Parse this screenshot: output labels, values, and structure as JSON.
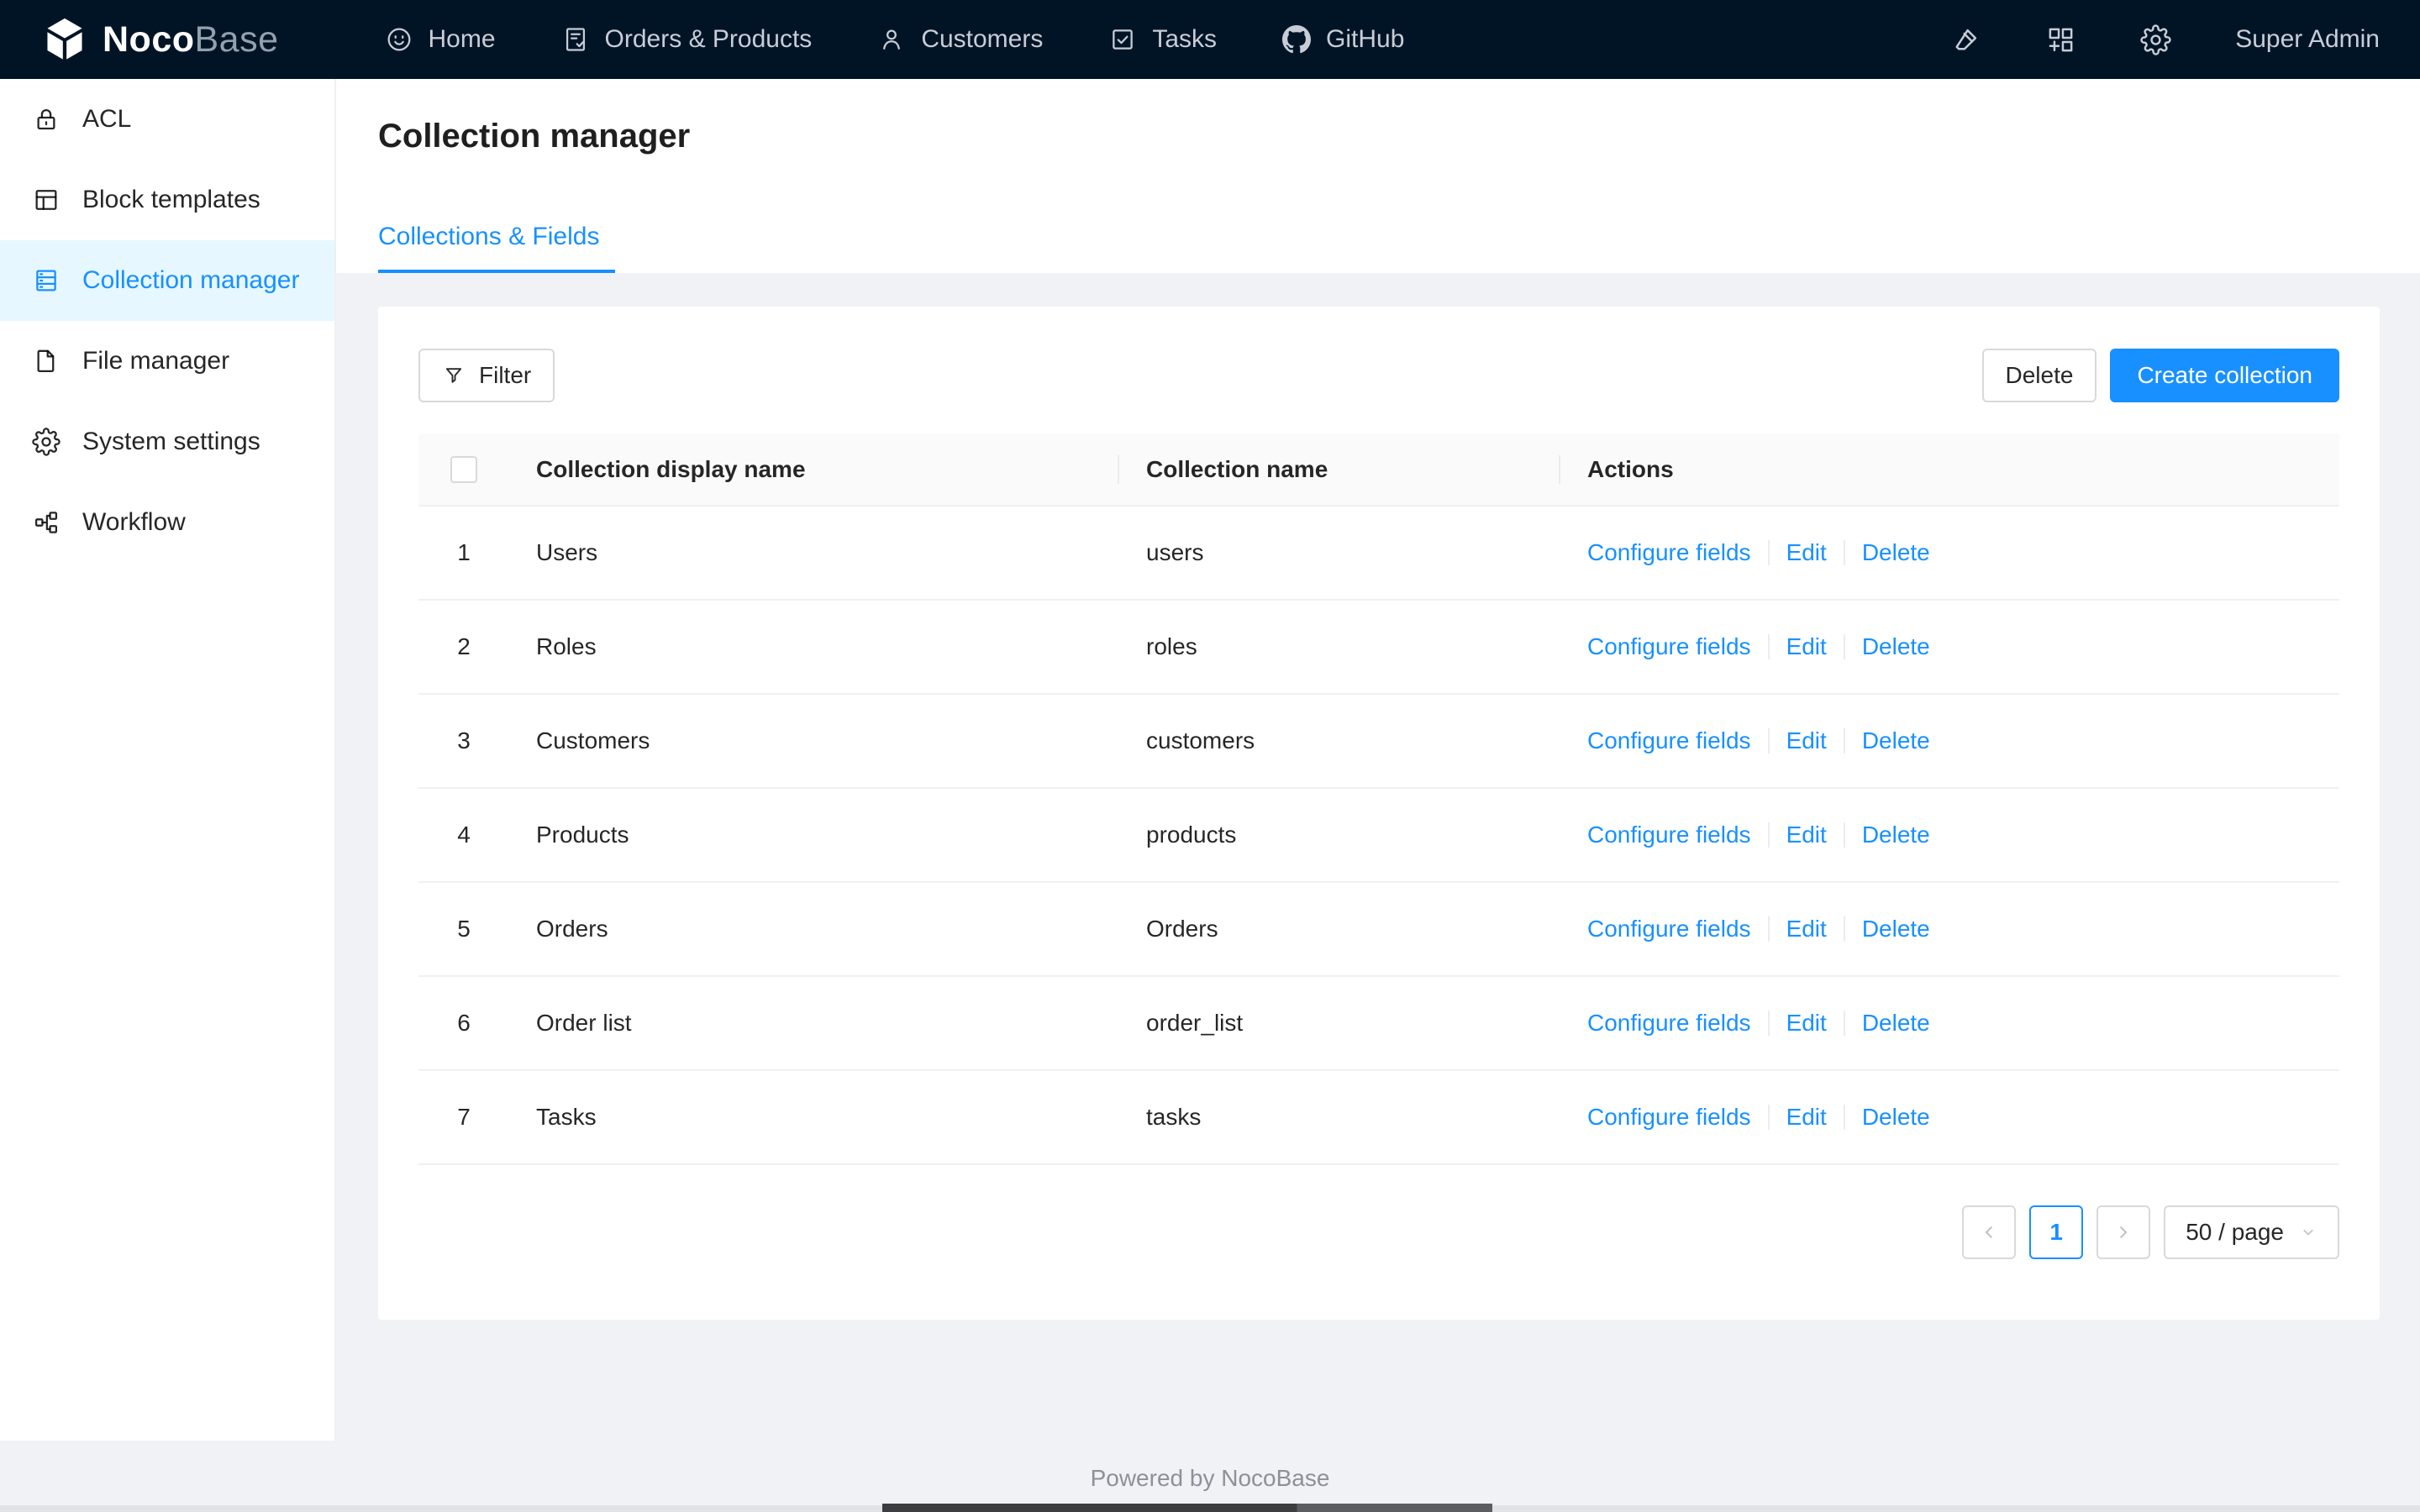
{
  "navbar": {
    "logo": {
      "noco": "Noco",
      "base": "Base"
    },
    "items": [
      {
        "label": "Home",
        "icon": "smile-icon"
      },
      {
        "label": "Orders & Products",
        "icon": "file-done-icon"
      },
      {
        "label": "Customers",
        "icon": "user-icon"
      },
      {
        "label": "Tasks",
        "icon": "check-square-icon"
      },
      {
        "label": "GitHub",
        "icon": "github-icon"
      }
    ],
    "user": "Super Admin"
  },
  "sidebar": {
    "items": [
      {
        "label": "ACL",
        "icon": "lock-icon",
        "active": false
      },
      {
        "label": "Block templates",
        "icon": "layout-icon",
        "active": false
      },
      {
        "label": "Collection manager",
        "icon": "database-icon",
        "active": true
      },
      {
        "label": "File manager",
        "icon": "file-icon",
        "active": false
      },
      {
        "label": "System settings",
        "icon": "gear-icon",
        "active": false
      },
      {
        "label": "Workflow",
        "icon": "partition-icon",
        "active": false
      }
    ]
  },
  "page": {
    "title": "Collection manager",
    "active_tab": "Collections & Fields"
  },
  "toolbar": {
    "filter_label": "Filter",
    "delete_label": "Delete",
    "create_label": "Create collection"
  },
  "table": {
    "headers": {
      "display_name": "Collection display name",
      "name": "Collection name",
      "actions": "Actions"
    },
    "action_labels": {
      "configure": "Configure fields",
      "edit": "Edit",
      "delete": "Delete"
    },
    "rows": [
      {
        "index": "1",
        "display_name": "Users",
        "name": "users"
      },
      {
        "index": "2",
        "display_name": "Roles",
        "name": "roles"
      },
      {
        "index": "3",
        "display_name": "Customers",
        "name": "customers"
      },
      {
        "index": "4",
        "display_name": "Products",
        "name": "products"
      },
      {
        "index": "5",
        "display_name": "Orders",
        "name": "Orders"
      },
      {
        "index": "6",
        "display_name": "Order list",
        "name": "order_list"
      },
      {
        "index": "7",
        "display_name": "Tasks",
        "name": "tasks"
      }
    ]
  },
  "pagination": {
    "current_page": "1",
    "page_size": "50 / page"
  },
  "footer": {
    "text": "Powered by NocoBase"
  },
  "colors": {
    "primary": "#1890ff",
    "navbar_bg": "#011426",
    "sidebar_selected_bg": "#e6f7ff",
    "content_bg": "#f0f2f5",
    "card_bg": "#ffffff"
  }
}
